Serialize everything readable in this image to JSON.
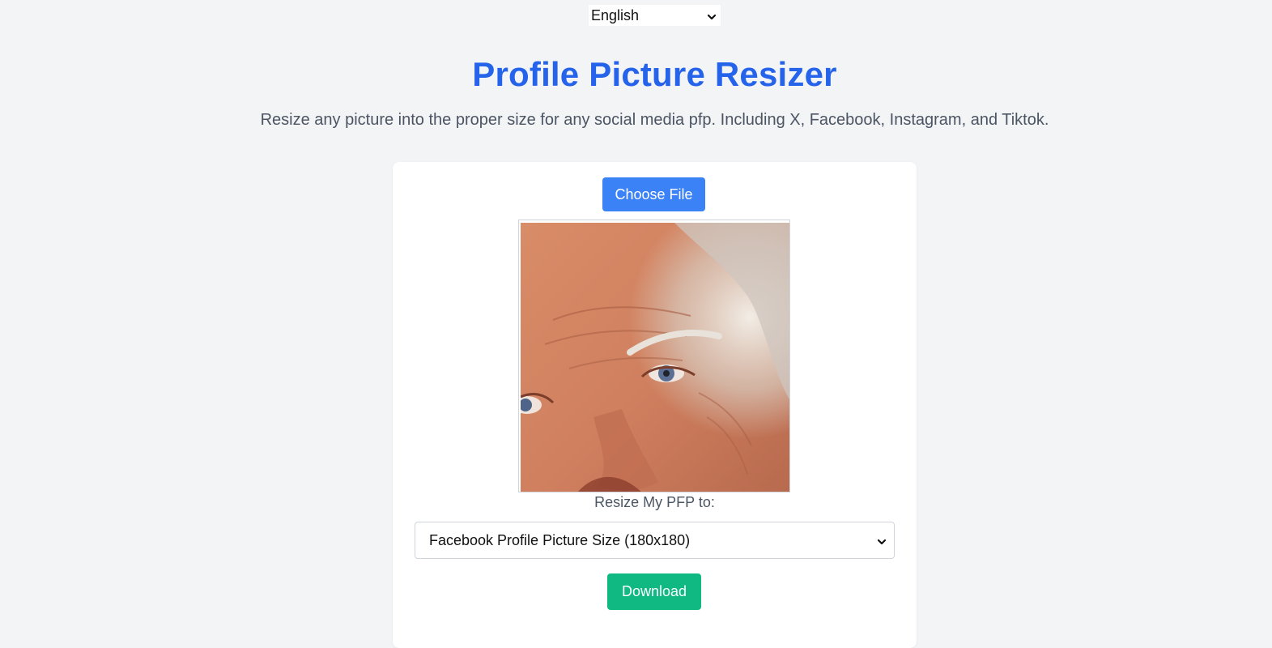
{
  "language_select": {
    "selected": "English",
    "icon": "chevron-down-icon"
  },
  "header": {
    "title": "Profile Picture Resizer",
    "subtitle": "Resize any picture into the proper size for any social media pfp. Including X, Facebook, Instagram, and Tiktok."
  },
  "uploader": {
    "choose_label": "Choose File",
    "resize_label": "Resize My PFP to:",
    "size_select": {
      "selected": "Facebook Profile Picture Size (180x180)",
      "icon": "chevron-down-icon"
    },
    "download_label": "Download"
  },
  "colors": {
    "background": "#f3f4f6",
    "title": "#2563eb",
    "choose_button": "#3b82f6",
    "download_button": "#10b981"
  }
}
